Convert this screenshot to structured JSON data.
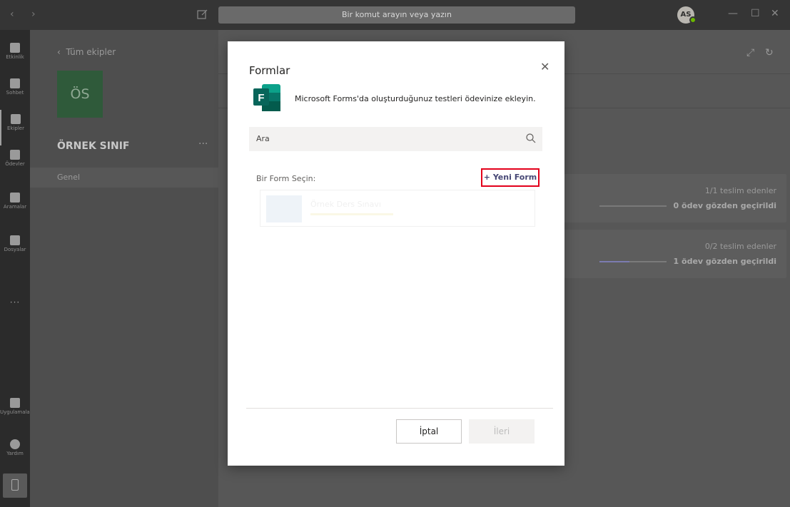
{
  "titlebar": {
    "search_placeholder": "Bir komut arayın veya yazın",
    "avatar_initials": "AS"
  },
  "rail": {
    "items": [
      {
        "label": "Etkinlik"
      },
      {
        "label": "Sohbet"
      },
      {
        "label": "Ekipler"
      },
      {
        "label": "Ödevler"
      },
      {
        "label": "Aramalar"
      },
      {
        "label": "Dosyalar"
      }
    ],
    "more": "···",
    "apps": "Uygulamalar",
    "help": "Yardım"
  },
  "teampanel": {
    "back_label": "Tüm ekipler",
    "tile_initials": "ÖS",
    "team_name": "ÖRNEK SINIF",
    "more": "···",
    "channel": "Genel"
  },
  "main": {
    "cards": [
      {
        "submitted": "1/1 teslim edenler",
        "reviewed": "0 ödev gözden geçirildi",
        "progress": 0.0
      },
      {
        "submitted": "0/2 teslim edenler",
        "reviewed": "1 ödev gözden geçirildi",
        "progress": 0.45
      }
    ]
  },
  "dialog": {
    "title": "Formlar",
    "description": "Microsoft Forms'da oluşturduğunuz testleri ödevinize ekleyin.",
    "search_placeholder": "Ara",
    "pick_label": "Bir Form Seçin:",
    "new_form_label": "+ Yeni Form",
    "forms": [
      {
        "name": "Örnek Ders Sınavı"
      }
    ],
    "cancel_label": "İptal",
    "next_label": "İleri"
  },
  "colors": {
    "accent": "#464775",
    "highlight_border": "#e3001b",
    "forms_brand": "#077568"
  }
}
